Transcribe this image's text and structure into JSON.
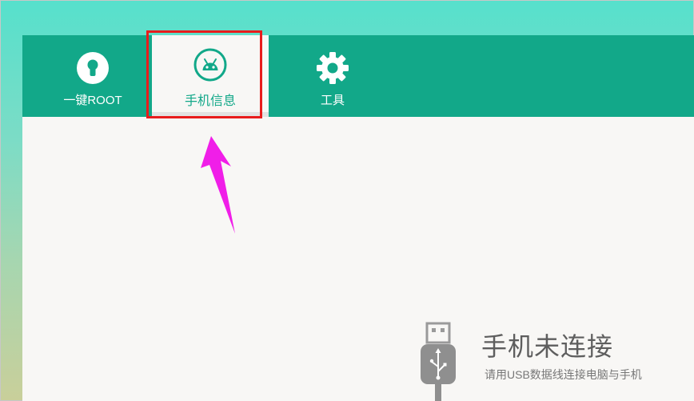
{
  "toolbar": {
    "tabs": [
      {
        "id": "root",
        "label": "一键ROOT",
        "icon": "keyhole-icon",
        "selected": false
      },
      {
        "id": "info",
        "label": "手机信息",
        "icon": "android-icon",
        "selected": true
      },
      {
        "id": "tools",
        "label": "工具",
        "icon": "gear-icon",
        "selected": false
      }
    ]
  },
  "status": {
    "title": "手机未连接",
    "subtitle": "请用USB数据线连接电脑与手机",
    "icon": "usb-cable-icon"
  },
  "colors": {
    "toolbar": "#12a889",
    "content": "#f8f7f5",
    "highlight": "#e81c1c",
    "arrow": "#f01ee8"
  },
  "annotations": {
    "highlight": "red-box",
    "arrow": "magenta-arrow"
  }
}
